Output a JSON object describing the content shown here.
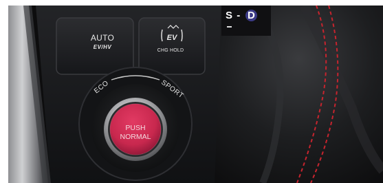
{
  "buttons": {
    "auto": {
      "label": "AUTO",
      "sublabel": "EV/HV"
    },
    "ev": {
      "icon": "ev-mode-icon",
      "label": "CHG HOLD"
    }
  },
  "dial": {
    "left_label": "ECO",
    "right_label": "SPORT"
  },
  "push_button": {
    "line1": "PUSH",
    "line2": "NORMAL",
    "color": "#c8284e"
  },
  "shift_indicator": {
    "left": "S",
    "separator": "-",
    "right": "D",
    "minus": "–",
    "highlight_color": "#3b3a86"
  },
  "colors": {
    "stitching": "#c7242e",
    "panel": "#1b1c1e"
  }
}
